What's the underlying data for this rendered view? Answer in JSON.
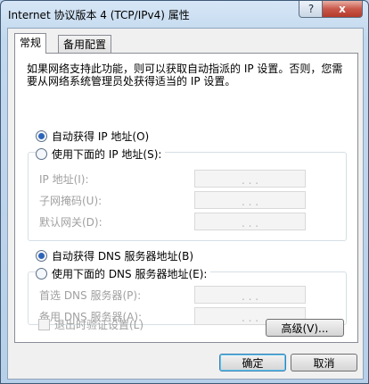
{
  "window": {
    "title": "Internet 协议版本 4 (TCP/IPv4) 属性",
    "help_label": "?",
    "close_label": "x"
  },
  "tabs": [
    {
      "label": "常规",
      "active": true
    },
    {
      "label": "备用配置",
      "active": false
    }
  ],
  "general": {
    "description": "如果网络支持此功能，则可以获取自动指派的 IP 设置。否则，您需要从网络系统管理员处获得适当的 IP 设置。",
    "ip_auto_label": "自动获得 IP 地址(O)",
    "ip_manual_label": "使用下面的 IP 地址(S):",
    "ip_auto_selected": true,
    "ip_fields": [
      {
        "label": "IP 地址(I):",
        "value": ". . ."
      },
      {
        "label": "子网掩码(U):",
        "value": ". . ."
      },
      {
        "label": "默认网关(D):",
        "value": ". . ."
      }
    ],
    "dns_auto_label": "自动获得 DNS 服务器地址(B)",
    "dns_manual_label": "使用下面的 DNS 服务器地址(E):",
    "dns_auto_selected": true,
    "dns_fields": [
      {
        "label": "首选 DNS 服务器(P):",
        "value": ". . ."
      },
      {
        "label": "备用 DNS 服务器(A):",
        "value": ". . ."
      }
    ],
    "validate_label": "退出时验证设置(L)",
    "advanced_label": "高级(V)..."
  },
  "buttons": {
    "ok_label": "确定",
    "cancel_label": "取消"
  }
}
